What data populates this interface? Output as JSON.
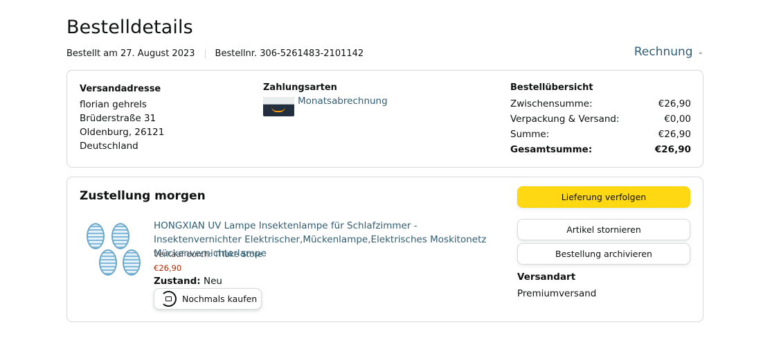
{
  "header": {
    "title": "Bestelldetails",
    "ordered_on": "Bestellt am 27. August 2023",
    "order_number": "Bestellnr. 306-5261483-2101142",
    "invoice_label": "Rechnung"
  },
  "summary": {
    "address": {
      "title": "Versandadresse",
      "lines": [
        "florian gehrels",
        "Brüderstraße 31",
        "Oldenburg, 26121",
        "Deutschland"
      ]
    },
    "payment": {
      "title": "Zahlungsarten",
      "method": "Monatsabrechnung"
    },
    "overview": {
      "title": "Bestellübersicht",
      "rows": [
        {
          "label": "Zwischensumme:",
          "value": "€26,90"
        },
        {
          "label": "Verpackung & Versand:",
          "value": "€0,00"
        },
        {
          "label": "Summe:",
          "value": "€26,90"
        }
      ],
      "total": {
        "label": "Gesamtsumme:",
        "value": "€26,90"
      }
    }
  },
  "delivery": {
    "title": "Zustellung morgen",
    "product": {
      "name": "HONGXIAN UV Lampe Insektenlampe für Schlafzimmer - Insektenvernichter Elektrischer,Mückenlampe,Elektrisches Moskitonetz Mückenvernichterlampe",
      "seller_prefix": "Verkauf durch:",
      "seller": "TiTake Store",
      "price": "€26,90",
      "condition_label": "Zustand:",
      "condition": "Neu",
      "rebuy_label": "Nochmals kaufen"
    },
    "buttons": {
      "track": "Lieferung verfolgen",
      "cancel": "Artikel stornieren",
      "archive": "Bestellung archivieren"
    },
    "shipping": {
      "title": "Versandart",
      "value": "Premiumversand"
    }
  },
  "colors": {
    "link": "#2f5d73",
    "price": "#b12704",
    "primary_button": "#ffd814"
  }
}
